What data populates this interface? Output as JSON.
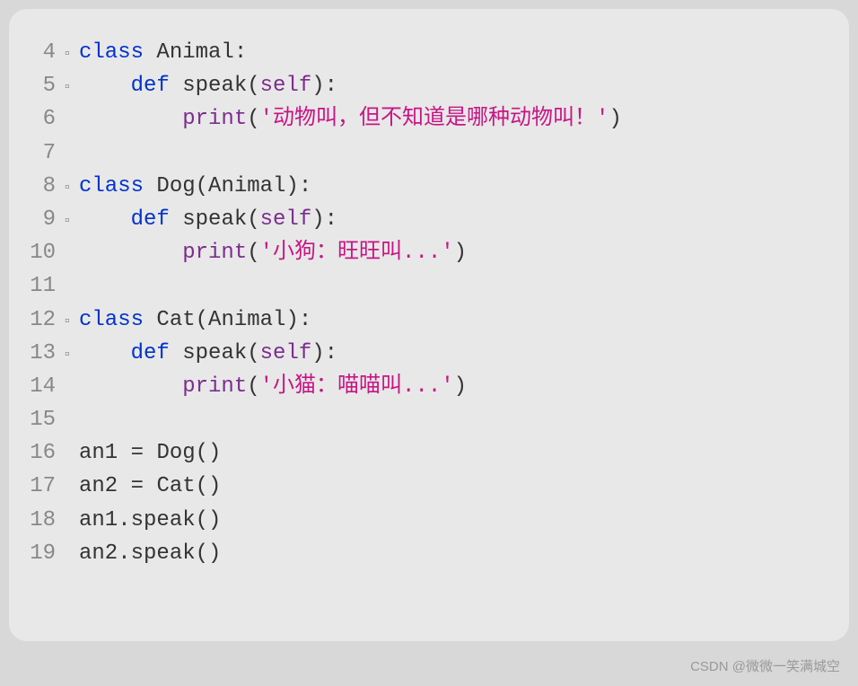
{
  "gutter": {
    "line4": "4",
    "line5": "5",
    "line6": "6",
    "line7": "7",
    "line8": "8",
    "line9": "9",
    "line10": "10",
    "line11": "11",
    "line12": "12",
    "line13": "13",
    "line14": "14",
    "line15": "15",
    "line16": "16",
    "line17": "17",
    "line18": "18",
    "line19": "19",
    "fold": "▫"
  },
  "code": {
    "kw_class": "class",
    "kw_def": "def",
    "cls_animal": "Animal",
    "cls_dog": "Dog",
    "cls_cat": "Cat",
    "fn_speak": "speak",
    "fn_print": "print",
    "param_self": "self",
    "str_animal": "'动物叫，但不知道是哪种动物叫！'",
    "str_dog": "'小狗：旺旺叫...'",
    "str_cat": "'小猫：喵喵叫...'",
    "var_an1": "an1",
    "var_an2": "an2",
    "assign_dog": "Dog()",
    "assign_cat": "Cat()",
    "call_an1": "an1.speak()",
    "call_an2": "an2.speak()",
    "colon": ":",
    "lparen": "(",
    "rparen": ")",
    "eq": " = "
  },
  "watermark": "CSDN @微微一笑满城空"
}
